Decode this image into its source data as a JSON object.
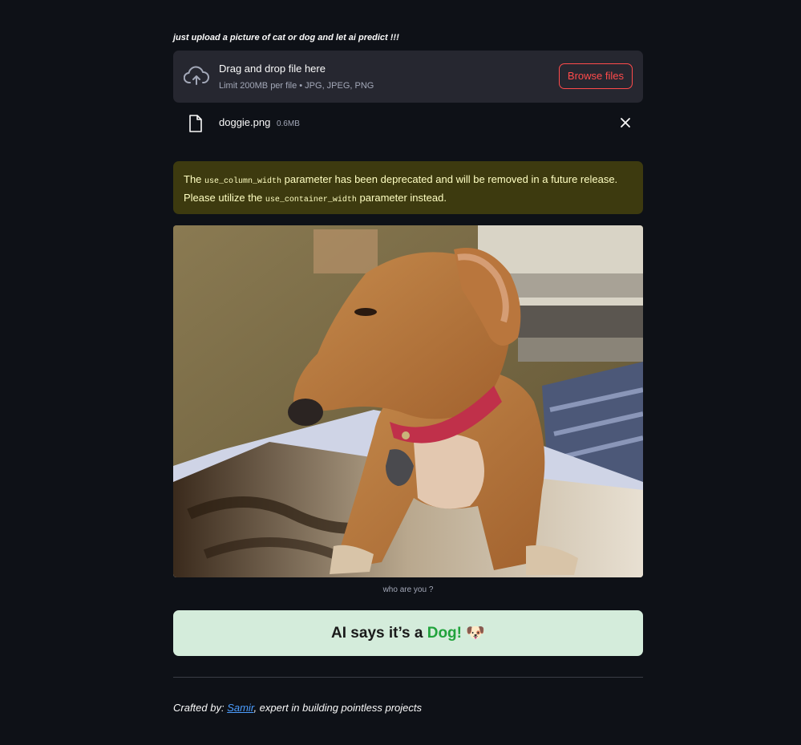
{
  "tagline": "just upload a picture of cat or dog and let ai predict !!!",
  "uploader": {
    "title": "Drag and drop file here",
    "subtitle": "Limit 200MB per file • JPG, JPEG, PNG",
    "browse_label": "Browse files",
    "icon": "cloud-upload-icon"
  },
  "file": {
    "name": "doggie.png",
    "size": "0.6MB",
    "icon": "file-icon",
    "remove_icon": "close-icon"
  },
  "warning": {
    "part1": "The ",
    "code1": "use_column_width",
    "part2": " parameter has been deprecated and will be removed in a future release. Please utilize the ",
    "code2": "use_container_width",
    "part3": " parameter instead."
  },
  "image": {
    "caption": "who are you ?"
  },
  "result": {
    "prefix": "AI says it’s a ",
    "label": "Dog!",
    "emoji": "🐶"
  },
  "footer": {
    "prefix": "Crafted by: ",
    "link_text": "Samir",
    "suffix": ", expert in building pointless projects"
  },
  "colors": {
    "background": "#0e1117",
    "accent": "#ff4b4b",
    "warning_bg": "#3d3a0f",
    "success_bg": "#d4ecdb",
    "dog_label": "#21a33c",
    "link": "#4c9eff"
  }
}
